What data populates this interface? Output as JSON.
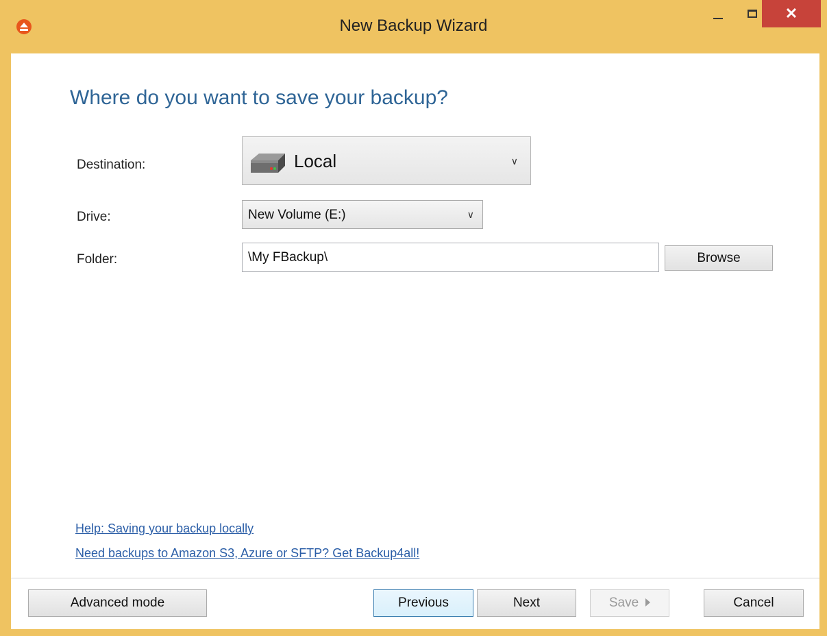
{
  "window": {
    "title": "New Backup Wizard",
    "close_glyph": "✕"
  },
  "page": {
    "heading": "Where do you want to save your backup?"
  },
  "form": {
    "destination_label": "Destination:",
    "destination_value": "Local",
    "drive_label": "Drive:",
    "drive_value": "New Volume (E:)",
    "folder_label": "Folder:",
    "folder_value": "\\My FBackup\\",
    "browse_label": "Browse"
  },
  "links": {
    "help": "Help: Saving your backup locally",
    "promo": "Need backups to Amazon S3, Azure or SFTP? Get Backup4all!"
  },
  "footer": {
    "advanced_label": "Advanced mode",
    "previous_label": "Previous",
    "next_label": "Next",
    "save_label": "Save",
    "cancel_label": "Cancel"
  },
  "colors": {
    "frame": "#efc361",
    "heading": "#2f6596",
    "link": "#2b5ea7",
    "close": "#c7433a"
  },
  "icons": {
    "app": "app-logo-icon",
    "destination": "hard-drive-icon",
    "dropdown": "chevron-down-icon"
  }
}
